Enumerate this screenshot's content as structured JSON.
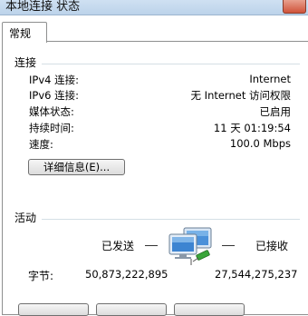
{
  "window": {
    "title": "本地连接 状态"
  },
  "tabs": [
    {
      "label": "常规"
    }
  ],
  "connection": {
    "section_title": "连接",
    "rows": [
      {
        "label": "IPv4 连接:",
        "value": "Internet"
      },
      {
        "label": "IPv6 连接:",
        "value": "无 Internet 访问权限"
      },
      {
        "label": "媒体状态:",
        "value": "已启用"
      },
      {
        "label": "持续时间:",
        "value": "11 天 01:19:54"
      },
      {
        "label": "速度:",
        "value": "100.0 Mbps"
      }
    ],
    "details_button": "详细信息(E)..."
  },
  "activity": {
    "section_title": "活动",
    "sent_label": "已发送",
    "received_label": "已接收",
    "bytes_label": "字节:",
    "bytes_sent": "50,873,222,895",
    "bytes_received": "27,544,275,237"
  },
  "colors": {
    "separator": "#d5dfe5",
    "monitor_blue": "#4a90d9",
    "cable_green": "#3aa53a"
  }
}
